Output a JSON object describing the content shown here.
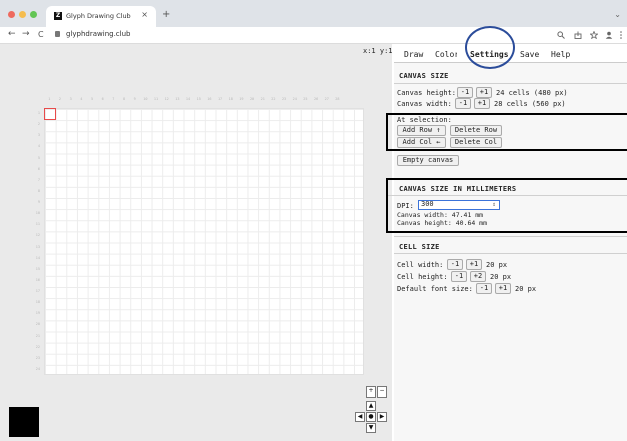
{
  "browser": {
    "tab_title": "Glyph Drawing Club",
    "favicon_glyph": "Z",
    "tab_close": "×",
    "new_tab": "+",
    "tabs_chevron": "⌄",
    "url": "glyphdrawing.club",
    "back": "←",
    "forward": "→",
    "reload": "C",
    "icons": [
      "search-icon",
      "share-icon",
      "star-icon",
      "profile-icon",
      "menu-icon"
    ],
    "traffic_light_colors": [
      "#ee6a5e",
      "#f5bd4f",
      "#62c554"
    ]
  },
  "coords": "x:1 y:1",
  "rulers": {
    "columns": [
      "1",
      "2",
      "3",
      "4",
      "5",
      "6",
      "7",
      "8",
      "9",
      "10",
      "11",
      "12",
      "13",
      "14",
      "15",
      "16",
      "17",
      "18",
      "19",
      "20",
      "21",
      "22",
      "23",
      "24",
      "25",
      "26",
      "27",
      "28"
    ],
    "rows": [
      "1",
      "2",
      "3",
      "4",
      "5",
      "6",
      "7",
      "8",
      "9",
      "10",
      "11",
      "12",
      "13",
      "14",
      "15",
      "16",
      "17",
      "18",
      "19",
      "20",
      "21",
      "22",
      "23",
      "24"
    ]
  },
  "colors": {
    "selection": "#e84a4a",
    "highlight_ring": "#2b4c9a",
    "current_color": "#000000",
    "dpi_focus": "#3b73d9"
  },
  "controls": {
    "add_col_symbol": "+",
    "remove_col_symbol": "−",
    "up": "▲",
    "down": "▼",
    "left": "◀",
    "right": "▶",
    "center": "●"
  },
  "tabs": {
    "draw": "Draw",
    "color": "Color",
    "settings": "Settings",
    "save": "Save",
    "help": "Help"
  },
  "canvas_size": {
    "title": "CANVAS SIZE",
    "height_label": "Canvas height:",
    "height_value": "24 cells (480 px)",
    "width_label": "Canvas width:",
    "width_value": "28 cells (560 px)",
    "minus": "-1",
    "plus": "+1",
    "at_selection": "At selection:",
    "add_row": "Add Row ↑",
    "delete_row": "Delete Row",
    "add_col": "Add Col ←",
    "delete_col": "Delete Col",
    "empty_canvas": "Empty canvas"
  },
  "canvas_mm": {
    "title": "CANVAS SIZE IN MILLIMETERS",
    "dpi_label": "DPI:",
    "dpi_value": "300",
    "dpi_arrow": "⇕",
    "width_text": "Canvas width: 47.41 mm",
    "height_text": "Canvas height: 40.64 mm"
  },
  "cell_size": {
    "title": "CELL SIZE",
    "width_label": "Cell width:",
    "width_minus": "-1",
    "width_plus": "+1",
    "width_value": "20 px",
    "height_label": "Cell height:",
    "height_minus": "-1",
    "height_plus": "+2",
    "height_value": "20 px",
    "font_label": "Default font size:",
    "font_minus": "-1",
    "font_plus": "+1",
    "font_value": "20 px"
  }
}
